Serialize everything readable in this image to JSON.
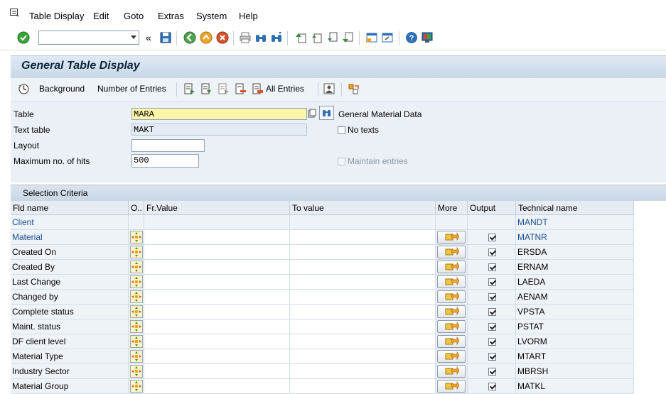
{
  "menu": {
    "items": [
      "Table Display",
      "Edit",
      "Goto",
      "Extras",
      "System",
      "Help"
    ]
  },
  "toolbar": {
    "command_value": "",
    "double_arrow": "«"
  },
  "title": "General Table Display",
  "app_toolbar": {
    "background": "Background",
    "number_of_entries": "Number of Entries",
    "all_entries": "All Entries"
  },
  "form": {
    "table_label": "Table",
    "table_value": "MARA",
    "table_desc": "General Material Data",
    "text_table_label": "Text table",
    "text_table_value": "MAKT",
    "no_texts_label": "No texts",
    "layout_label": "Layout",
    "layout_value": "",
    "max_hits_label": "Maximum no. of hits",
    "max_hits_value": "500",
    "maintain_entries_label": "Maintain entries"
  },
  "selection": {
    "title": "Selection Criteria",
    "columns": [
      "Fld name",
      "O..",
      "Fr.Value",
      "To value",
      "More",
      "Output",
      "Technical name"
    ],
    "rows": [
      {
        "name": "Client",
        "tech": "MANDT",
        "link": true,
        "op": false
      },
      {
        "name": "Material",
        "tech": "MATNR",
        "link": true,
        "op": true
      },
      {
        "name": "Created On",
        "tech": "ERSDA",
        "link": false,
        "op": true
      },
      {
        "name": "Created By",
        "tech": "ERNAM",
        "link": false,
        "op": true
      },
      {
        "name": "Last Change",
        "tech": "LAEDA",
        "link": false,
        "op": true
      },
      {
        "name": "Changed by",
        "tech": "AENAM",
        "link": false,
        "op": true
      },
      {
        "name": "Complete status",
        "tech": "VPSTA",
        "link": false,
        "op": true
      },
      {
        "name": "Maint. status",
        "tech": "PSTAT",
        "link": false,
        "op": true
      },
      {
        "name": "DF client level",
        "tech": "LVORM",
        "link": false,
        "op": true
      },
      {
        "name": "Material Type",
        "tech": "MTART",
        "link": false,
        "op": true
      },
      {
        "name": "Industry Sector",
        "tech": "MBRSH",
        "link": false,
        "op": true
      },
      {
        "name": "Material Group",
        "tech": "MATKL",
        "link": false,
        "op": true
      }
    ]
  },
  "colors": {
    "link": "#1c4f8f",
    "required_field": "#fff7a8",
    "panel": "#eaf0f6"
  }
}
